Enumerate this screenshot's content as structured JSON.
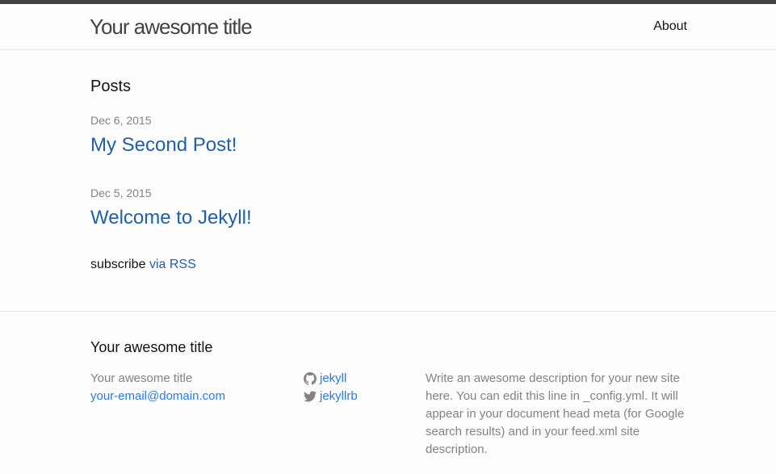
{
  "header": {
    "site_title": "Your awesome title",
    "nav": {
      "about_label": "About"
    }
  },
  "main": {
    "heading": "Posts",
    "posts": [
      {
        "date": "Dec 6, 2015",
        "title": "My Second Post!"
      },
      {
        "date": "Dec 5, 2015",
        "title": "Welcome to Jekyll!"
      }
    ],
    "rss": {
      "prefix": "subscribe",
      "link_label": "via RSS"
    }
  },
  "footer": {
    "heading": "Your awesome title",
    "contact": {
      "name": "Your awesome title",
      "email": "your-email@domain.com"
    },
    "social": {
      "github": {
        "icon": "github-icon",
        "label": "jekyll"
      },
      "twitter": {
        "icon": "twitter-icon",
        "label": "jekyllrb"
      }
    },
    "description": "Write an awesome description for your new site here. You can edit this line in _config.yml. It will appear in your document head meta (for Google search results) and in your feed.xml site description."
  },
  "colors": {
    "accent_link": "#1f5fab",
    "footer_link": "#2a7ae2",
    "muted_text": "#828282",
    "top_bar": "#424242"
  }
}
